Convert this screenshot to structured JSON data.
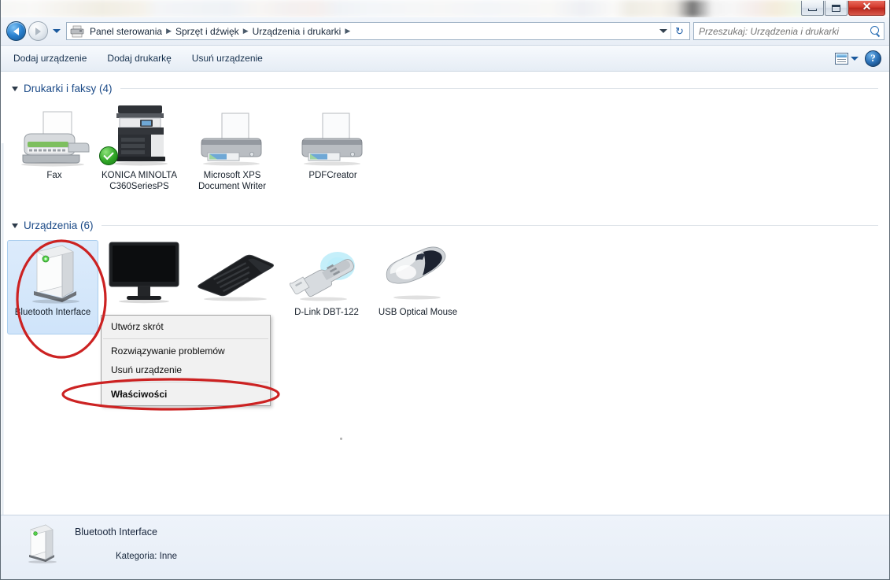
{
  "window": {
    "controls": {
      "minimize_label": "Minimalizuj",
      "maximize_label": "Maksymalizuj",
      "close_label": "✕"
    }
  },
  "address_bar": {
    "back_label": "Wstecz",
    "forward_label": "Dalej",
    "history_label": "Ostatnie lokalizacje",
    "icon": "printer-icon",
    "breadcrumbs": [
      {
        "label": "Panel sterowania"
      },
      {
        "label": "Sprzęt i dźwięk"
      },
      {
        "label": "Urządzenia i drukarki"
      }
    ],
    "separator": "▶",
    "refresh_label": "↻"
  },
  "search": {
    "placeholder": "Przeszukaj: Urządzenia i drukarki",
    "value": "",
    "icon": "search-icon"
  },
  "command_bar": {
    "items": [
      {
        "label": "Dodaj urządzenie"
      },
      {
        "label": "Dodaj drukarkę"
      },
      {
        "label": "Usuń urządzenie"
      }
    ],
    "view_icon": "view-options-icon",
    "help_label": "?"
  },
  "groups": [
    {
      "title": "Drukarki i faksy (4)",
      "items": [
        {
          "label": "Fax",
          "icon": "fax-icon",
          "selected": false,
          "default_badge": false
        },
        {
          "label": "KONICA MINOLTA C360SeriesPS",
          "icon": "multifunction-printer-icon",
          "selected": false,
          "default_badge": true
        },
        {
          "label": "Microsoft XPS Document Writer",
          "icon": "printer-icon",
          "selected": false,
          "default_badge": false
        },
        {
          "label": "PDFCreator",
          "icon": "printer-icon",
          "selected": false,
          "default_badge": false
        }
      ]
    },
    {
      "title": "Urządzenia (6)",
      "items": [
        {
          "label": "Bluetooth Interface",
          "icon": "computer-tower-icon",
          "selected": true,
          "default_badge": false
        },
        {
          "label": "",
          "icon": "monitor-icon",
          "selected": false,
          "default_badge": false
        },
        {
          "label": "",
          "icon": "keyboard-icon",
          "selected": false,
          "default_badge": false
        },
        {
          "label": "D-Link DBT-122",
          "icon": "usb-dongle-icon",
          "selected": false,
          "default_badge": false
        },
        {
          "label": "USB Optical Mouse",
          "icon": "mouse-icon",
          "selected": false,
          "default_badge": false
        },
        {
          "label": "",
          "icon": "blank-icon",
          "selected": false,
          "default_badge": false
        }
      ]
    }
  ],
  "context_menu": {
    "items": [
      {
        "label": "Utwórz skrót",
        "bold": false,
        "separator_after": true
      },
      {
        "label": "Rozwiązywanie problemów",
        "bold": false,
        "separator_after": false
      },
      {
        "label": "Usuń urządzenie",
        "bold": false,
        "separator_after": true
      },
      {
        "label": "Właściwości",
        "bold": true,
        "separator_after": false
      }
    ]
  },
  "details_pane": {
    "icon": "computer-tower-icon",
    "title": "Bluetooth Interface",
    "category_label": "Kategoria:",
    "category_value": "Inne"
  },
  "annotations": {
    "color": "#cc2222",
    "highlight_device": "Bluetooth Interface",
    "highlight_menu_item": "Właściwości"
  }
}
